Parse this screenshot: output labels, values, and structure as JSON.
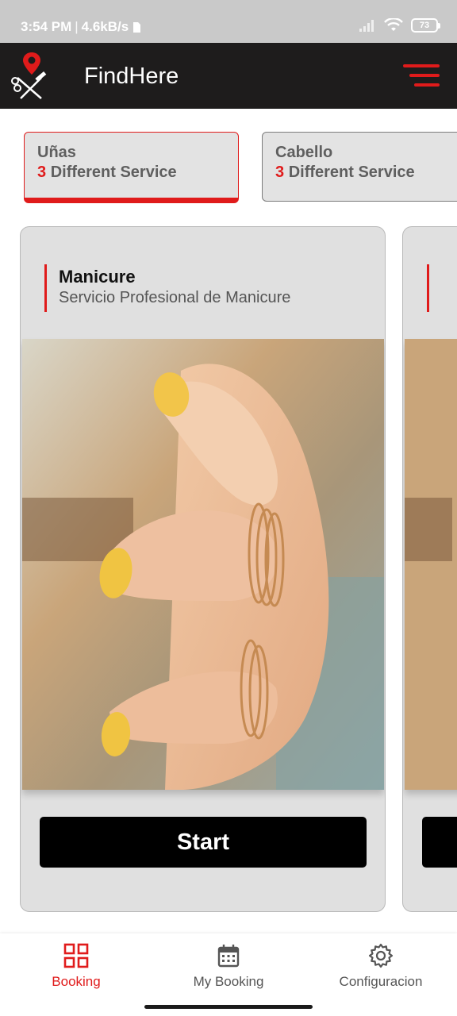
{
  "status_bar": {
    "time": "3:54 PM",
    "separator": "|",
    "network_speed": "4.6kB/s",
    "battery_level": "73"
  },
  "app_bar": {
    "title": "FindHere",
    "logo_icon": "location-pin-scissors-comb-icon",
    "menu_icon": "hamburger-menu-icon",
    "accent_color": "#e01b1b",
    "background_color": "#1e1c1c"
  },
  "categories": [
    {
      "name": "Uñas",
      "count": "3",
      "count_label": "Different Service",
      "active": true
    },
    {
      "name": "Cabello",
      "count": "3",
      "count_label": "Different Service",
      "active": false
    }
  ],
  "services": [
    {
      "title": "Manicure",
      "subtitle": "Servicio Profesional de Manicure",
      "image": "hand-with-yellow-painted-nails-and-gold-rings",
      "button_label": "Start"
    }
  ],
  "bottom_nav": {
    "items": [
      {
        "label": "Booking",
        "icon": "grid-icon",
        "active": true
      },
      {
        "label": "My Booking",
        "icon": "calendar-icon",
        "active": false
      },
      {
        "label": "Configuracion",
        "icon": "gear-icon",
        "active": false
      }
    ]
  }
}
